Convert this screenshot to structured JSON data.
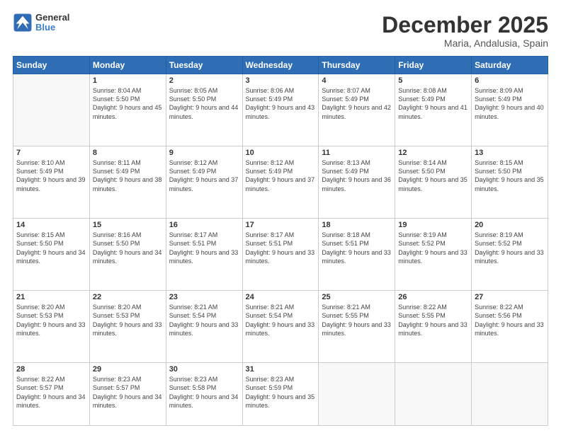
{
  "header": {
    "logo_line1": "General",
    "logo_line2": "Blue",
    "month": "December 2025",
    "location": "Maria, Andalusia, Spain"
  },
  "weekdays": [
    "Sunday",
    "Monday",
    "Tuesday",
    "Wednesday",
    "Thursday",
    "Friday",
    "Saturday"
  ],
  "weeks": [
    [
      {
        "day": "",
        "sunrise": "",
        "sunset": "",
        "daylight": ""
      },
      {
        "day": "1",
        "sunrise": "Sunrise: 8:04 AM",
        "sunset": "Sunset: 5:50 PM",
        "daylight": "Daylight: 9 hours and 45 minutes."
      },
      {
        "day": "2",
        "sunrise": "Sunrise: 8:05 AM",
        "sunset": "Sunset: 5:50 PM",
        "daylight": "Daylight: 9 hours and 44 minutes."
      },
      {
        "day": "3",
        "sunrise": "Sunrise: 8:06 AM",
        "sunset": "Sunset: 5:49 PM",
        "daylight": "Daylight: 9 hours and 43 minutes."
      },
      {
        "day": "4",
        "sunrise": "Sunrise: 8:07 AM",
        "sunset": "Sunset: 5:49 PM",
        "daylight": "Daylight: 9 hours and 42 minutes."
      },
      {
        "day": "5",
        "sunrise": "Sunrise: 8:08 AM",
        "sunset": "Sunset: 5:49 PM",
        "daylight": "Daylight: 9 hours and 41 minutes."
      },
      {
        "day": "6",
        "sunrise": "Sunrise: 8:09 AM",
        "sunset": "Sunset: 5:49 PM",
        "daylight": "Daylight: 9 hours and 40 minutes."
      }
    ],
    [
      {
        "day": "7",
        "sunrise": "Sunrise: 8:10 AM",
        "sunset": "Sunset: 5:49 PM",
        "daylight": "Daylight: 9 hours and 39 minutes."
      },
      {
        "day": "8",
        "sunrise": "Sunrise: 8:11 AM",
        "sunset": "Sunset: 5:49 PM",
        "daylight": "Daylight: 9 hours and 38 minutes."
      },
      {
        "day": "9",
        "sunrise": "Sunrise: 8:12 AM",
        "sunset": "Sunset: 5:49 PM",
        "daylight": "Daylight: 9 hours and 37 minutes."
      },
      {
        "day": "10",
        "sunrise": "Sunrise: 8:12 AM",
        "sunset": "Sunset: 5:49 PM",
        "daylight": "Daylight: 9 hours and 37 minutes."
      },
      {
        "day": "11",
        "sunrise": "Sunrise: 8:13 AM",
        "sunset": "Sunset: 5:49 PM",
        "daylight": "Daylight: 9 hours and 36 minutes."
      },
      {
        "day": "12",
        "sunrise": "Sunrise: 8:14 AM",
        "sunset": "Sunset: 5:50 PM",
        "daylight": "Daylight: 9 hours and 35 minutes."
      },
      {
        "day": "13",
        "sunrise": "Sunrise: 8:15 AM",
        "sunset": "Sunset: 5:50 PM",
        "daylight": "Daylight: 9 hours and 35 minutes."
      }
    ],
    [
      {
        "day": "14",
        "sunrise": "Sunrise: 8:15 AM",
        "sunset": "Sunset: 5:50 PM",
        "daylight": "Daylight: 9 hours and 34 minutes."
      },
      {
        "day": "15",
        "sunrise": "Sunrise: 8:16 AM",
        "sunset": "Sunset: 5:50 PM",
        "daylight": "Daylight: 9 hours and 34 minutes."
      },
      {
        "day": "16",
        "sunrise": "Sunrise: 8:17 AM",
        "sunset": "Sunset: 5:51 PM",
        "daylight": "Daylight: 9 hours and 33 minutes."
      },
      {
        "day": "17",
        "sunrise": "Sunrise: 8:17 AM",
        "sunset": "Sunset: 5:51 PM",
        "daylight": "Daylight: 9 hours and 33 minutes."
      },
      {
        "day": "18",
        "sunrise": "Sunrise: 8:18 AM",
        "sunset": "Sunset: 5:51 PM",
        "daylight": "Daylight: 9 hours and 33 minutes."
      },
      {
        "day": "19",
        "sunrise": "Sunrise: 8:19 AM",
        "sunset": "Sunset: 5:52 PM",
        "daylight": "Daylight: 9 hours and 33 minutes."
      },
      {
        "day": "20",
        "sunrise": "Sunrise: 8:19 AM",
        "sunset": "Sunset: 5:52 PM",
        "daylight": "Daylight: 9 hours and 33 minutes."
      }
    ],
    [
      {
        "day": "21",
        "sunrise": "Sunrise: 8:20 AM",
        "sunset": "Sunset: 5:53 PM",
        "daylight": "Daylight: 9 hours and 33 minutes."
      },
      {
        "day": "22",
        "sunrise": "Sunrise: 8:20 AM",
        "sunset": "Sunset: 5:53 PM",
        "daylight": "Daylight: 9 hours and 33 minutes."
      },
      {
        "day": "23",
        "sunrise": "Sunrise: 8:21 AM",
        "sunset": "Sunset: 5:54 PM",
        "daylight": "Daylight: 9 hours and 33 minutes."
      },
      {
        "day": "24",
        "sunrise": "Sunrise: 8:21 AM",
        "sunset": "Sunset: 5:54 PM",
        "daylight": "Daylight: 9 hours and 33 minutes."
      },
      {
        "day": "25",
        "sunrise": "Sunrise: 8:21 AM",
        "sunset": "Sunset: 5:55 PM",
        "daylight": "Daylight: 9 hours and 33 minutes."
      },
      {
        "day": "26",
        "sunrise": "Sunrise: 8:22 AM",
        "sunset": "Sunset: 5:55 PM",
        "daylight": "Daylight: 9 hours and 33 minutes."
      },
      {
        "day": "27",
        "sunrise": "Sunrise: 8:22 AM",
        "sunset": "Sunset: 5:56 PM",
        "daylight": "Daylight: 9 hours and 33 minutes."
      }
    ],
    [
      {
        "day": "28",
        "sunrise": "Sunrise: 8:22 AM",
        "sunset": "Sunset: 5:57 PM",
        "daylight": "Daylight: 9 hours and 34 minutes."
      },
      {
        "day": "29",
        "sunrise": "Sunrise: 8:23 AM",
        "sunset": "Sunset: 5:57 PM",
        "daylight": "Daylight: 9 hours and 34 minutes."
      },
      {
        "day": "30",
        "sunrise": "Sunrise: 8:23 AM",
        "sunset": "Sunset: 5:58 PM",
        "daylight": "Daylight: 9 hours and 34 minutes."
      },
      {
        "day": "31",
        "sunrise": "Sunrise: 8:23 AM",
        "sunset": "Sunset: 5:59 PM",
        "daylight": "Daylight: 9 hours and 35 minutes."
      },
      {
        "day": "",
        "sunrise": "",
        "sunset": "",
        "daylight": ""
      },
      {
        "day": "",
        "sunrise": "",
        "sunset": "",
        "daylight": ""
      },
      {
        "day": "",
        "sunrise": "",
        "sunset": "",
        "daylight": ""
      }
    ]
  ]
}
